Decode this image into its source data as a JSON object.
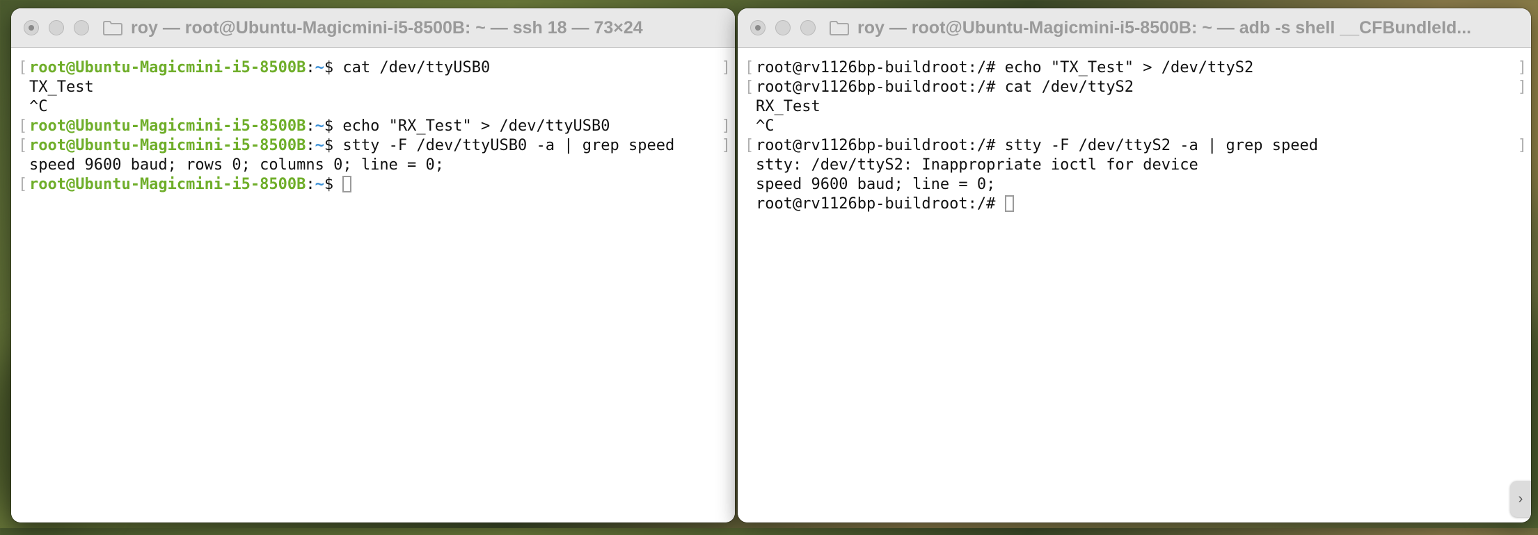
{
  "left_window": {
    "title": "roy — root@Ubuntu-Magicmini-i5-8500B: ~ — ssh 18 — 73×24",
    "prompt_user": "root@Ubuntu-Magicmini-i5-8500B",
    "prompt_path": "~",
    "lines": [
      {
        "type": "prompt",
        "command": "cat /dev/ttyUSB0"
      },
      {
        "type": "output",
        "text": "TX_Test"
      },
      {
        "type": "output",
        "text": "^C"
      },
      {
        "type": "prompt",
        "command": "echo \"RX_Test\" > /dev/ttyUSB0"
      },
      {
        "type": "prompt",
        "command": "stty -F /dev/ttyUSB0 -a | grep speed"
      },
      {
        "type": "output",
        "text": "speed 9600 baud; rows 0; columns 0; line = 0;"
      },
      {
        "type": "prompt",
        "command": ""
      }
    ]
  },
  "right_window": {
    "title": "roy — root@Ubuntu-Magicmini-i5-8500B: ~ — adb -s shell __CFBundleId...",
    "lines": [
      {
        "type": "prompt",
        "text": "root@rv1126bp-buildroot:/# echo \"TX_Test\" > /dev/ttyS2"
      },
      {
        "type": "prompt",
        "text": "root@rv1126bp-buildroot:/# cat /dev/ttyS2"
      },
      {
        "type": "output",
        "text": "RX_Test"
      },
      {
        "type": "output",
        "text": "^C"
      },
      {
        "type": "prompt",
        "text": "root@rv1126bp-buildroot:/# stty -F /dev/ttyS2 -a | grep speed"
      },
      {
        "type": "output",
        "text": "stty: /dev/ttyS2: Inappropriate ioctl for device"
      },
      {
        "type": "output",
        "text": "speed 9600 baud; line = 0;"
      },
      {
        "type": "prompt",
        "text": "root@rv1126bp-buildroot:/# "
      }
    ]
  },
  "colors": {
    "prompt_user": "#6fae2a",
    "prompt_path": "#3a8fd6"
  },
  "icons": {
    "window_controls": [
      "close-icon",
      "minimize-icon",
      "zoom-icon"
    ],
    "title_icon": "folder-icon"
  }
}
